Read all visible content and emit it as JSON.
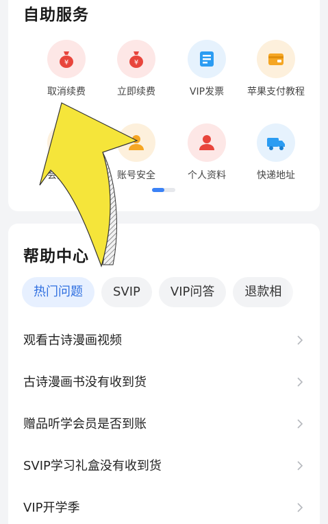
{
  "self_service": {
    "title": "自助服务",
    "items": [
      {
        "label": "取消续费",
        "icon": "money-bag-icon",
        "bg": "#fde7e6",
        "fg": "#e8453c"
      },
      {
        "label": "立即续费",
        "icon": "money-bag-icon",
        "bg": "#fde7e6",
        "fg": "#e8453c"
      },
      {
        "label": "VIP发票",
        "icon": "invoice-icon",
        "bg": "#e6f2fd",
        "fg": "#2b9cf2"
      },
      {
        "label": "苹果支付教程",
        "icon": "wallet-icon",
        "bg": "#fdf0dc",
        "fg": "#f5a623"
      },
      {
        "label": "会员购买",
        "icon": "vip-icon",
        "bg": "#fdf0dc",
        "fg": "#f5a623"
      },
      {
        "label": "账号安全",
        "icon": "user-shield-icon",
        "bg": "#fdf0dc",
        "fg": "#f5a623"
      },
      {
        "label": "个人资料",
        "icon": "person-icon",
        "bg": "#fde7e6",
        "fg": "#e8453c"
      },
      {
        "label": "快递地址",
        "icon": "truck-icon",
        "bg": "#e6f2fd",
        "fg": "#2b9cf2"
      }
    ]
  },
  "help_center": {
    "title": "帮助中心",
    "tabs": [
      "热门问题",
      "SVIP",
      "VIP问答",
      "退款相"
    ],
    "active_tab": 0,
    "questions": [
      "观看古诗漫画视频",
      "古诗漫画书没有收到货",
      "赠品听学会员是否到账",
      "SVIP学习礼盒没有收到货",
      "VIP开学季"
    ]
  },
  "colors": {
    "accent": "#2f6fe0",
    "arrow": "#f5e53a"
  }
}
